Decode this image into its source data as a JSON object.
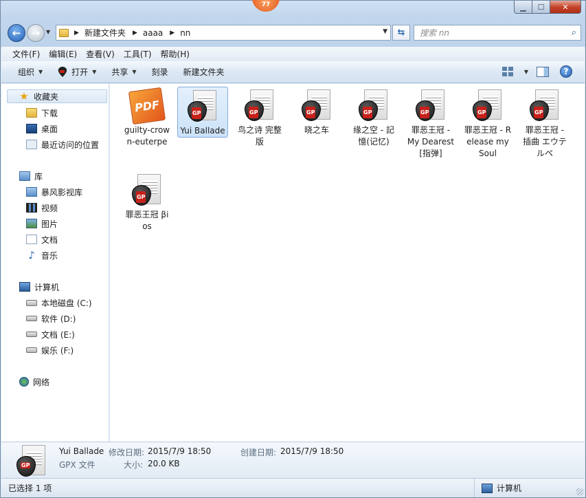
{
  "titlebar": {
    "notify_count": "77",
    "minimize": "▁",
    "maximize": "☐",
    "close": "✕"
  },
  "address": {
    "crumbs": [
      "新建文件夹",
      "aaaa",
      "nn"
    ],
    "search_placeholder": "搜索 nn"
  },
  "menu": [
    "文件(F)",
    "编辑(E)",
    "查看(V)",
    "工具(T)",
    "帮助(H)"
  ],
  "toolbar": {
    "organize": "组织",
    "open": "打开",
    "share": "共享",
    "burn": "刻录",
    "new_folder": "新建文件夹"
  },
  "nav": {
    "favorites": "收藏夹",
    "downloads": "下载",
    "desktop": "桌面",
    "recent": "最近访问的位置",
    "libraries": "库",
    "storm": "暴风影视库",
    "videos": "视频",
    "pictures": "图片",
    "documents": "文档",
    "music": "音乐",
    "computer": "计算机",
    "drive_c": "本地磁盘 (C:)",
    "drive_d": "软件 (D:)",
    "drive_e": "文档 (E:)",
    "drive_f": "娱乐 (F:)",
    "network": "网络"
  },
  "files": [
    {
      "name": "guilty-crown-euterpe",
      "type": "pdf",
      "icon_label": "PDF"
    },
    {
      "name": "Yui Ballade",
      "type": "gpx",
      "selected": true
    },
    {
      "name": "鸟之诗 完整版",
      "type": "gpx"
    },
    {
      "name": "晓之车",
      "type": "gpx"
    },
    {
      "name": "缘之空 - 記憶(记忆)",
      "type": "gpx"
    },
    {
      "name": "罪恶王冠 - My Dearest[指弹]",
      "type": "gpx"
    },
    {
      "name": "罪恶王冠 - Release my Soul",
      "type": "gpx"
    },
    {
      "name": "罪恶王冠 - 插曲 エウテルペ",
      "type": "gpx"
    },
    {
      "name": "罪恶王冠 βios",
      "type": "gpx"
    }
  ],
  "details": {
    "name": "Yui Ballade",
    "type": "GPX 文件",
    "modified_label": "修改日期:",
    "modified": "2015/7/9 18:50",
    "created_label": "创建日期:",
    "created": "2015/7/9 18:50",
    "size_label": "大小:",
    "size": "20.0 KB"
  },
  "status": {
    "selected": "已选择 1 项",
    "location": "计算机"
  }
}
